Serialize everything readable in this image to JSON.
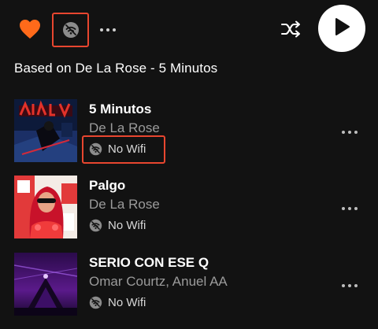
{
  "header": {
    "like_icon": "heart-filled-icon",
    "offline_icon": "no-wifi-icon",
    "more_icon": "more-horizontal-icon",
    "shuffle_icon": "shuffle-icon",
    "play_icon": "play-icon"
  },
  "subtitle": "Based on De La Rose - 5 Minutos",
  "tracks": [
    {
      "title": "5 Minutos",
      "artist": "De La Rose",
      "status": "No Wifi"
    },
    {
      "title": "Palgo",
      "artist": "De La Rose",
      "status": "No Wifi"
    },
    {
      "title": "SERIO CON ESE Q",
      "artist": "Omar Courtz, Anuel AA",
      "status": "No Wifi"
    }
  ],
  "colors": {
    "background": "#121212",
    "accent": "#ff6a1a",
    "highlight": "#e8462f",
    "secondary_text": "#9b9b9b"
  }
}
